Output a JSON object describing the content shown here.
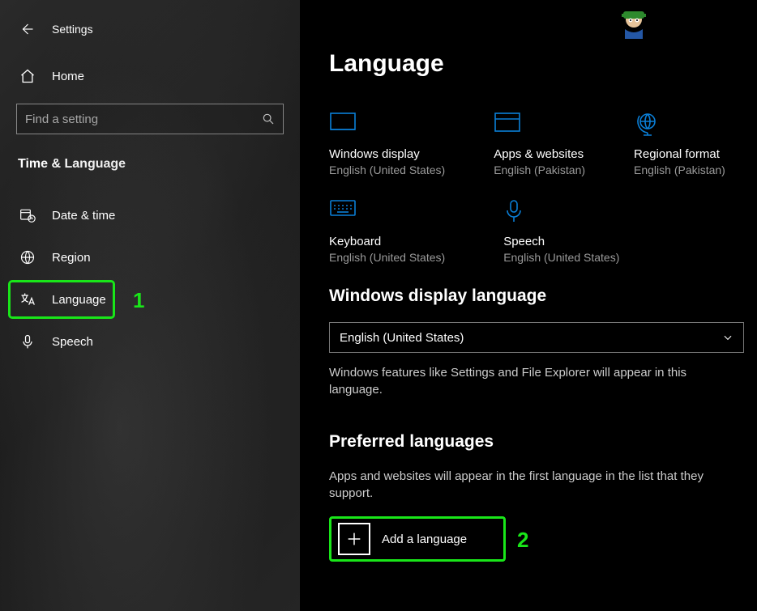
{
  "app_title": "Settings",
  "home_label": "Home",
  "search": {
    "placeholder": "Find a setting"
  },
  "category": "Time & Language",
  "nav": [
    {
      "label": "Date & time"
    },
    {
      "label": "Region"
    },
    {
      "label": "Language"
    },
    {
      "label": "Speech"
    }
  ],
  "callouts": {
    "one": "1",
    "two": "2"
  },
  "page_title": "Language",
  "tiles": {
    "windows_display": {
      "title": "Windows display",
      "sub": "English (United States)"
    },
    "apps_websites": {
      "title": "Apps & websites",
      "sub": "English (Pakistan)"
    },
    "regional_format": {
      "title": "Regional format",
      "sub": "English (Pakistan)"
    },
    "keyboard": {
      "title": "Keyboard",
      "sub": "English (United States)"
    },
    "speech": {
      "title": "Speech",
      "sub": "English (United States)"
    }
  },
  "display_lang": {
    "section_title": "Windows display language",
    "selected": "English (United States)",
    "help": "Windows features like Settings and File Explorer will appear in this language."
  },
  "preferred": {
    "section_title": "Preferred languages",
    "help": "Apps and websites will appear in the first language in the list that they support.",
    "add_label": "Add a language"
  }
}
